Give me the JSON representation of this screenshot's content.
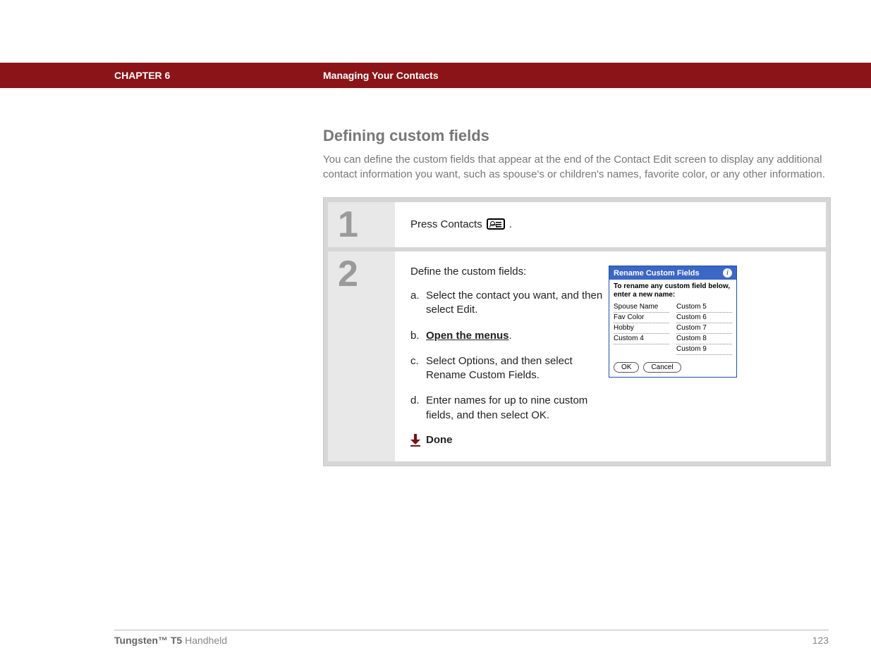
{
  "header": {
    "chapter": "CHAPTER 6",
    "section": "Managing Your Contacts"
  },
  "page": {
    "title": "Defining custom fields",
    "intro": "You can define the custom fields that appear at the end of the Contact Edit screen to display any additional contact information you want, such as spouse's or children's names, favorite color, or any other information."
  },
  "steps": {
    "one": {
      "num": "1",
      "text": "Press Contacts ",
      "trail": "."
    },
    "two": {
      "num": "2",
      "lead": "Define the custom fields:",
      "items": {
        "a": {
          "lbl": "a.",
          "txt": "Select the contact you want, and then select Edit."
        },
        "b": {
          "lbl": "b.",
          "link": "Open the menus",
          "trail": "."
        },
        "c": {
          "lbl": "c.",
          "txt": "Select Options, and then select Rename Custom Fields."
        },
        "d": {
          "lbl": "d.",
          "txt": "Enter names for up to nine custom fields, and then select OK."
        }
      },
      "done": "Done"
    }
  },
  "palm": {
    "title": "Rename Custom Fields",
    "sub": "To rename any custom field below, enter a new name:",
    "left": [
      "Spouse Name",
      "Fav Color",
      "Hobby",
      "Custom 4"
    ],
    "right": [
      "Custom 5",
      "Custom 6",
      "Custom 7",
      "Custom 8",
      "Custom 9"
    ],
    "ok": "OK",
    "cancel": "Cancel"
  },
  "footer": {
    "product_bold": "Tungsten™ T5",
    "product_rest": " Handheld",
    "page_number": "123"
  }
}
